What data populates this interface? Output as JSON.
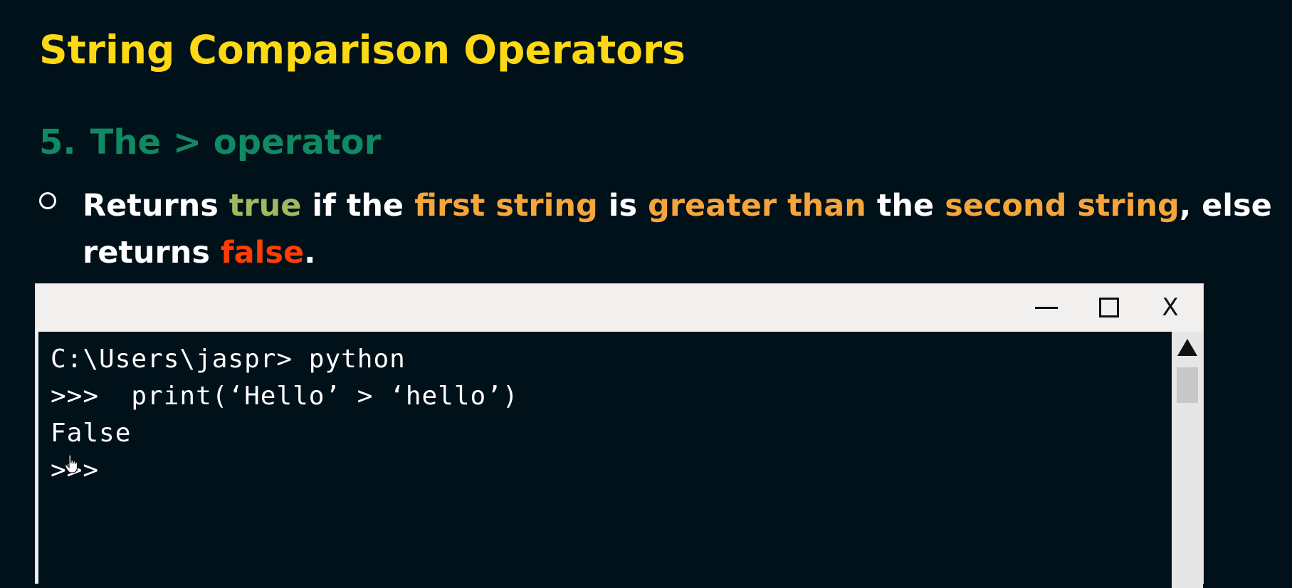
{
  "slide": {
    "title": "String Comparison Operators",
    "section_number": "5.",
    "section_title": "The > operator",
    "bullet": {
      "part1": "Returns ",
      "true_word": "true",
      "part2": " if the ",
      "first_string": "first string",
      "part3": " is ",
      "greater_than": "greater than",
      "part4": " the ",
      "second_string": "second string",
      "part5": ", else returns ",
      "false_word": "false",
      "part6": "."
    }
  },
  "terminal": {
    "lines": [
      "C:\\Users\\jaspr> python",
      ">>>  print(‘Hello’ > ‘hello’)",
      "False",
      ">>>"
    ],
    "close_label": "X"
  },
  "colors": {
    "background": "#00111a",
    "title": "#fdd814",
    "section": "#0f8a62",
    "true_highlight": "#a0b860",
    "keyword_highlight": "#f6a53a",
    "false_highlight": "#ff3d05"
  }
}
